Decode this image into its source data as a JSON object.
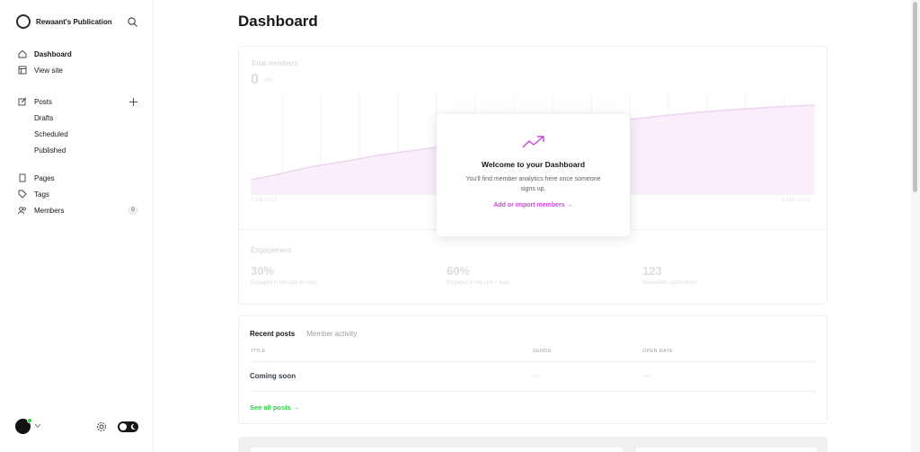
{
  "sidebar": {
    "publication_name": "Rewaant's Publication",
    "items": [
      {
        "label": "Dashboard",
        "icon": "home-icon"
      },
      {
        "label": "View site",
        "icon": "layout-icon"
      },
      {
        "label": "Posts",
        "icon": "edit-icon"
      },
      {
        "label": "Pages",
        "icon": "pages-icon"
      },
      {
        "label": "Tags",
        "icon": "tag-icon"
      },
      {
        "label": "Members",
        "icon": "members-icon"
      }
    ],
    "post_subitems": [
      "Drafts",
      "Scheduled",
      "Published"
    ],
    "members_count": "0"
  },
  "main": {
    "title": "Dashboard",
    "total_members": {
      "label": "Total members",
      "value": "0",
      "change": "0%",
      "date_start": "7 Apr 2023",
      "date_end": "6 May 2023"
    },
    "welcome": {
      "title": "Welcome to your Dashboard",
      "text": "You'll find member analytics here once someone signs up.",
      "link": "Add or import members →"
    },
    "engagement": {
      "label": "Engagement",
      "metrics": [
        {
          "value": "30%",
          "sub": "Engaged in the last 30 days"
        },
        {
          "value": "60%",
          "sub": "Engaged in the last 7 days"
        },
        {
          "value": "123",
          "sub": "Newsletter subscribers"
        }
      ]
    },
    "recent": {
      "tabs": [
        "Recent posts",
        "Member activity"
      ],
      "columns": [
        "TITLE",
        "SENDS",
        "OPEN RATE"
      ],
      "row": {
        "title": "Coming soon",
        "sends": "—",
        "open_rate": "—"
      },
      "see_all": "See all posts →"
    }
  },
  "colors": {
    "accent": "#c747d1",
    "green": "#30cf43",
    "chart_fill": "#f6e6f8"
  }
}
